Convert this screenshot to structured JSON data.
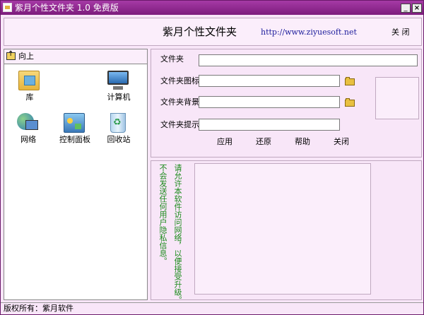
{
  "window": {
    "title": "紫月个性文件夹 1.0 免费版",
    "minimize_symbol": "_",
    "close_symbol": "×"
  },
  "header": {
    "title": "紫月个性文件夹",
    "url": "http://www.ziyuesoft.net",
    "close_label": "关 闭"
  },
  "left_pane": {
    "up_label": "向上",
    "items": [
      {
        "label": "库",
        "icon": "library-icon"
      },
      {
        "label": "计算机",
        "icon": "computer-icon"
      },
      {
        "label": "网络",
        "icon": "network-icon"
      },
      {
        "label": "控制面板",
        "icon": "control-panel-icon"
      },
      {
        "label": "回收站",
        "icon": "recycle-bin-icon"
      }
    ]
  },
  "form": {
    "folder_label": "文件夹",
    "folder_value": "",
    "icon_label": "文件夹图标",
    "icon_value": "",
    "background_label": "文件夹背景",
    "background_value": "",
    "tip_label": "文件夹提示",
    "tip_value": "",
    "buttons": {
      "apply": "应用",
      "restore": "还原",
      "help": "帮助",
      "close": "关闭"
    }
  },
  "notice": {
    "line1": "请允许本软件访问网络，以便接受升级。",
    "line2": "不会发送任何用户隐私信息。"
  },
  "status": {
    "text": "版权所有：紫月软件"
  }
}
